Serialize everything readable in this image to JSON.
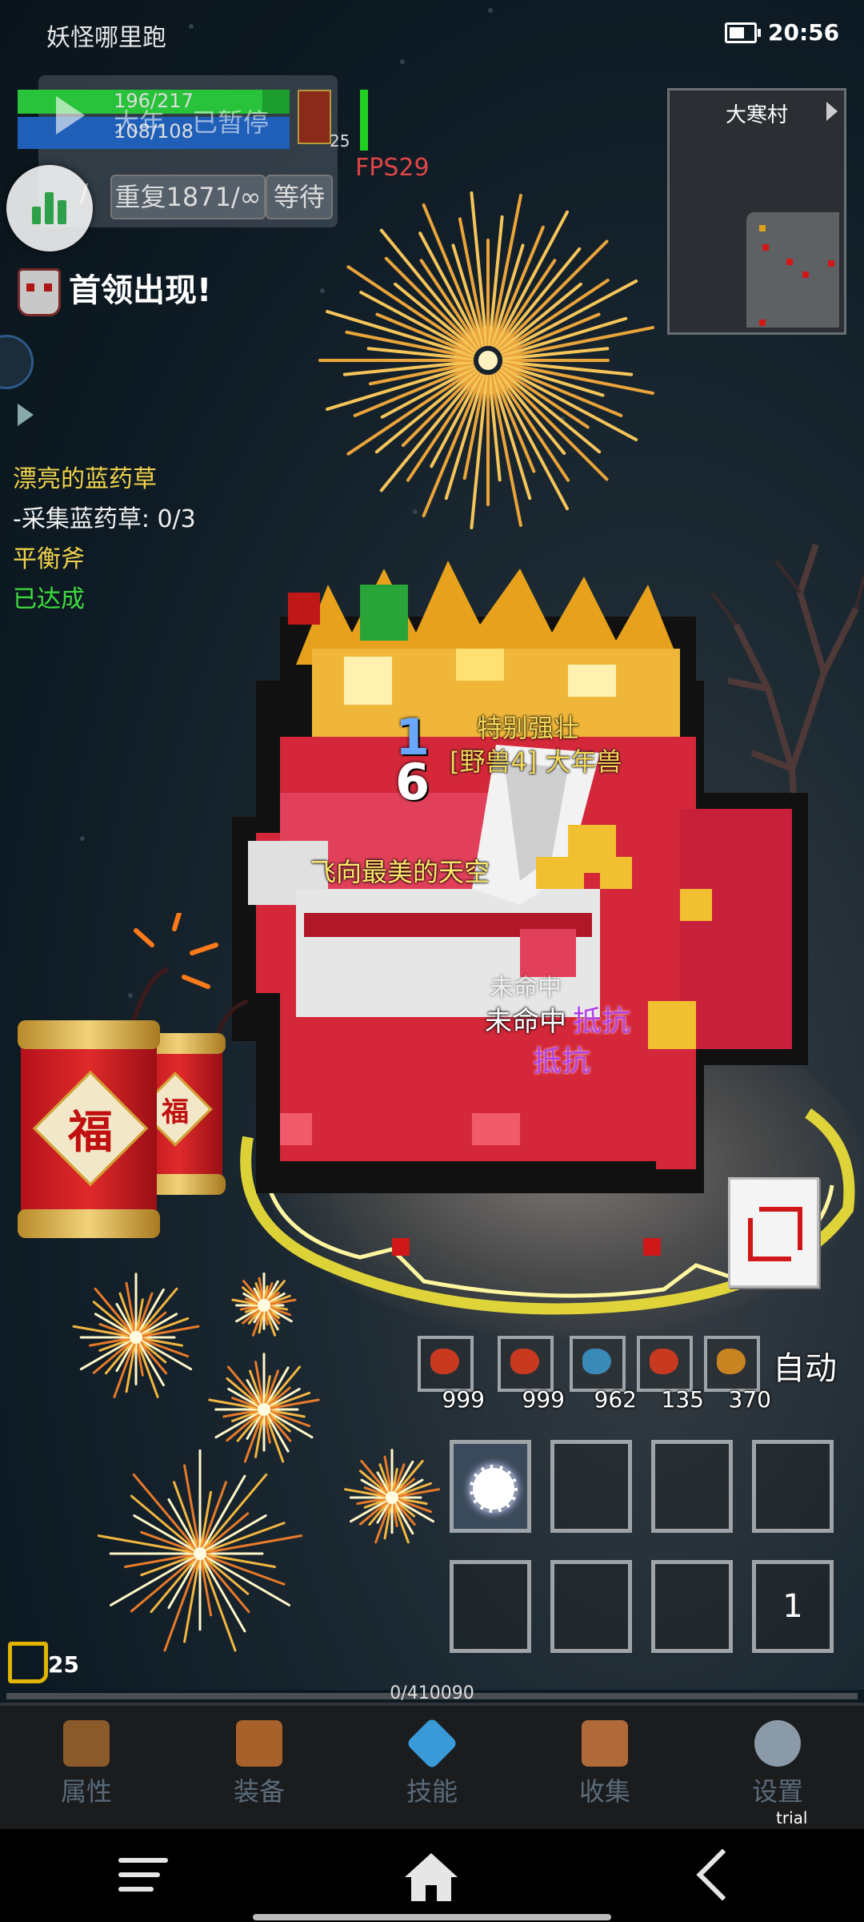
{
  "status_bar": {
    "app_title": "妖怪哪里跑",
    "time": "20:56"
  },
  "hud": {
    "hp_text": "196/217",
    "hp_fraction": 0.9,
    "mp_text": "108/108",
    "boss_overlay": "大年",
    "paused": "已暂停",
    "mini_level": "25",
    "fps": "FPS29",
    "slash": "/",
    "repeat_label": "重复1871/∞",
    "wait_label": "等待"
  },
  "boss_alert": "首领出现!",
  "quest": {
    "title": "漂亮的蓝药草",
    "objective": "-采集蓝药草: 0/3",
    "title2": "平衡斧",
    "status2": "已达成"
  },
  "minimap": {
    "name": "大寒村"
  },
  "monster": {
    "prefix": "特别强壮",
    "name": "[野兽4] 大年兽",
    "damage_1": "1",
    "damage_2": "6",
    "skill_text": "飞向最美的天空",
    "hit_ghost": "未命中",
    "hit_text": "未命中",
    "resist_1": "抵抗",
    "resist_2": "抵抗"
  },
  "firecracker": {
    "char": "福"
  },
  "items": [
    {
      "qty": "999",
      "color": "#c83a20"
    },
    {
      "qty": "999",
      "color": "#c83a20"
    },
    {
      "qty": "962",
      "color": "#3a8ab8"
    },
    {
      "qty": "135",
      "color": "#c83a20"
    },
    {
      "qty": "370",
      "color": "#c88420"
    }
  ],
  "auto_label": "自动",
  "skill_slot_number": "1",
  "player_level": "25",
  "exp_text": "0/410090",
  "menu": [
    {
      "label": "属性",
      "icon": "helmet-icon"
    },
    {
      "label": "装备",
      "icon": "bag-icon"
    },
    {
      "label": "技能",
      "icon": "crystal-icon"
    },
    {
      "label": "收集",
      "icon": "book-icon"
    },
    {
      "label": "设置",
      "icon": "gear-icon"
    }
  ],
  "trial_text": "trial version"
}
